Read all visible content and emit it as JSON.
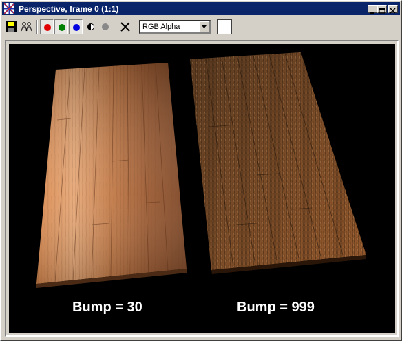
{
  "window": {
    "title": "Perspective, frame 0 (1:1)"
  },
  "toolbar": {
    "channel_select_value": "RGB Alpha",
    "channel_colors": {
      "red": "#e00000",
      "green": "#008000",
      "blue": "#0000e0",
      "gray": "#888888"
    }
  },
  "render": {
    "left_label": "Bump = 30",
    "right_label": "Bump = 999"
  }
}
